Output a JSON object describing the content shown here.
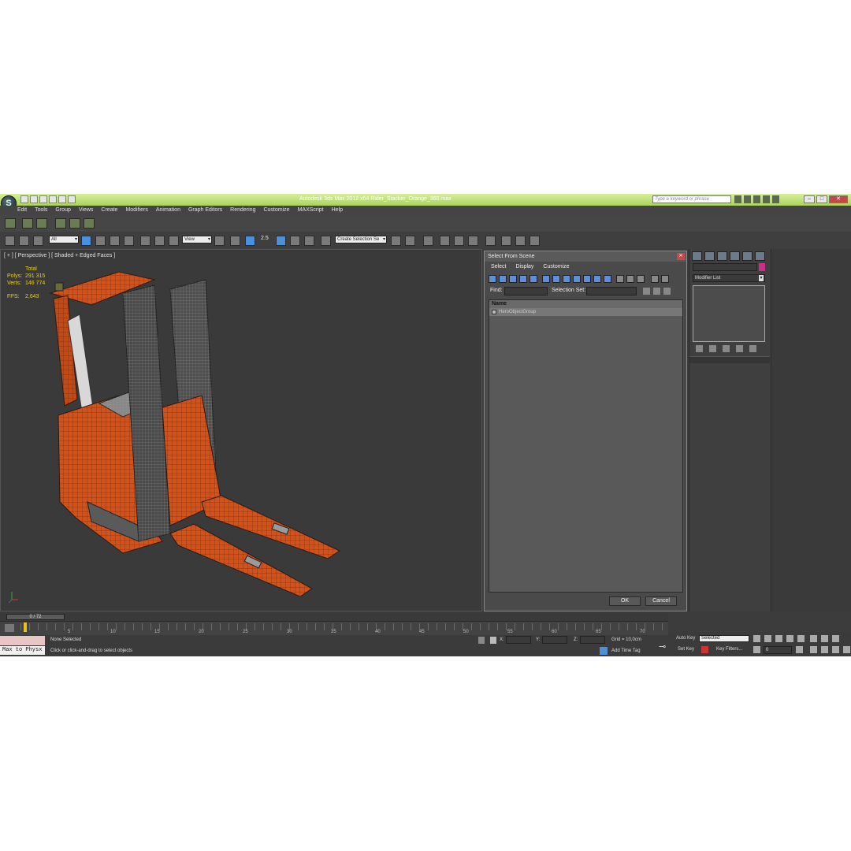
{
  "app": {
    "title": "Autodesk 3ds Max  2012 x64     Rider_Stacker_Orange_360.max",
    "logo": "S",
    "search_placeholder": "Type a keyword or phrase"
  },
  "menu": [
    "Edit",
    "Tools",
    "Group",
    "Views",
    "Create",
    "Modifiers",
    "Animation",
    "Graph Editors",
    "Rendering",
    "Customize",
    "MAXScript",
    "Help"
  ],
  "toolbar": {
    "filter_value": "All",
    "refcoord_value": "View",
    "snap_label": "2.5",
    "selection_set_value": "Create Selection Se"
  },
  "viewport": {
    "label": "[ + ] [ Perspective ] [ Shaded + Edged Faces ]",
    "stats": {
      "total_label": "Total",
      "polys_label": "Polys:",
      "polys_value": "291 315",
      "verts_label": "Verts:",
      "verts_value": "146 774",
      "fps_label": "FPS:",
      "fps_value": "2,643"
    }
  },
  "dialog": {
    "title": "Select From Scene",
    "menu": [
      "Select",
      "Display",
      "Customize"
    ],
    "find_label": "Find:",
    "selection_set_label": "Selection Set:",
    "column_name": "Name",
    "rows": [
      "HeroObjectGroup"
    ],
    "ok": "OK",
    "cancel": "Cancel"
  },
  "command_panel": {
    "modifier_list": "Modifier List",
    "object_color": "#c9308a"
  },
  "timeline": {
    "slider": "0 / 72",
    "ticks": [
      "5",
      "10",
      "15",
      "20",
      "25",
      "30",
      "35",
      "40",
      "45",
      "50",
      "55",
      "60",
      "65",
      "70"
    ]
  },
  "status": {
    "max_to_physx": "Max to Physx",
    "selection": "None Selected",
    "hint": "Click or click-and-drag to select objects",
    "x_label": "X:",
    "y_label": "Y:",
    "z_label": "Z:",
    "grid": "Grid = 10,0cm",
    "add_time_tag": "Add Time Tag"
  },
  "animation": {
    "auto_key": "Auto Key",
    "auto_key_mode": "Selected",
    "set_key": "Set Key",
    "key_filters": "Key Filters...",
    "frame": "0"
  },
  "colors": {
    "forklift_orange": "#d0531e",
    "titlebar_green": "#b9dd72",
    "accent_blue": "#4d8fd8"
  }
}
